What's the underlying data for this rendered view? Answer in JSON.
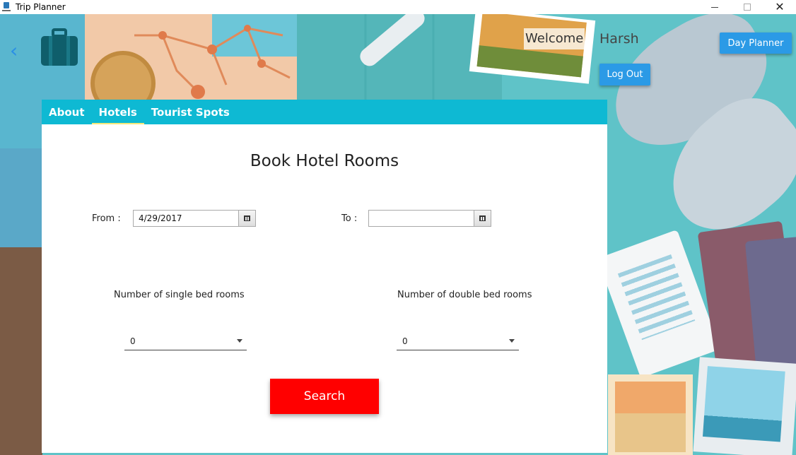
{
  "window": {
    "title": "Trip Planner",
    "controls": {
      "minimize": "",
      "maximize": "",
      "close": "✕"
    }
  },
  "header": {
    "back_glyph": "‹",
    "welcome_label": "Welcome",
    "username": "Harsh",
    "day_planner_label": "Day Planner",
    "logout_label": "Log Out"
  },
  "tabs": [
    {
      "label": "About",
      "active": false
    },
    {
      "label": "Hotels",
      "active": true
    },
    {
      "label": "Tourist Spots",
      "active": false
    }
  ],
  "booking": {
    "title": "Book Hotel Rooms",
    "from_label": "From :",
    "from_value": "4/29/2017",
    "to_label": "To :",
    "to_value": "",
    "single_label": "Number of single bed rooms",
    "single_value": "0",
    "double_label": "Number of double bed rooms",
    "double_value": "0",
    "search_label": "Search"
  },
  "colors": {
    "tab_bar": "#0eb9d3",
    "accent_blue": "#2b9ae6",
    "search_red": "#ff0000"
  }
}
